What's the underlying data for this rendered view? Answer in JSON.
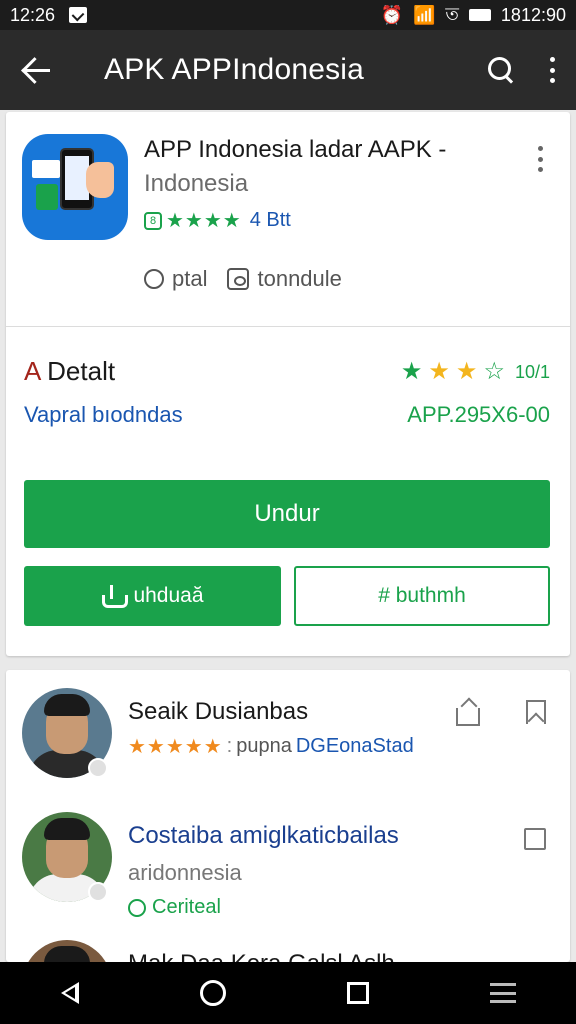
{
  "status": {
    "time": "12:26",
    "right_text": "ত",
    "clock": "1812:90"
  },
  "app_bar": {
    "title": "APK APPIndonesia"
  },
  "app_card": {
    "name": "APP Indonesia  ladar AAPK -",
    "developer": "Indonesia",
    "rating_badge": "8",
    "rating_stars": "★★★★",
    "rating_text": "4 Btt",
    "meta": [
      {
        "icon": "info-icon",
        "label": "ptal"
      },
      {
        "icon": "doc-icon",
        "label": "tonndule"
      }
    ]
  },
  "detail": {
    "title_prefix": "A",
    "title_rest": " Detalt",
    "subtitle": "Vapral bıodndas",
    "rating_count": "10/1",
    "version": "APP.295X6-00"
  },
  "buttons": {
    "primary": "Undur",
    "download": "uhduaă",
    "outline": "# buthmh"
  },
  "reviews": [
    {
      "name": "Seaik Dusianbas",
      "stars": "★★★★★",
      "separator": ":",
      "meta": "pupna",
      "meta_blue": "DGEonaStad"
    },
    {
      "name": "Costaiba amiglkaticbailas",
      "sub": "aridonnesia",
      "tag": "Ceriteal"
    },
    {
      "name": "Mak Daa Kera Galsl Aslh"
    }
  ],
  "colors": {
    "accent_green": "#1aa24b",
    "link_blue": "#1a56b0",
    "app_bar": "#2b2b2b",
    "star_gold": "#f3b51e"
  }
}
